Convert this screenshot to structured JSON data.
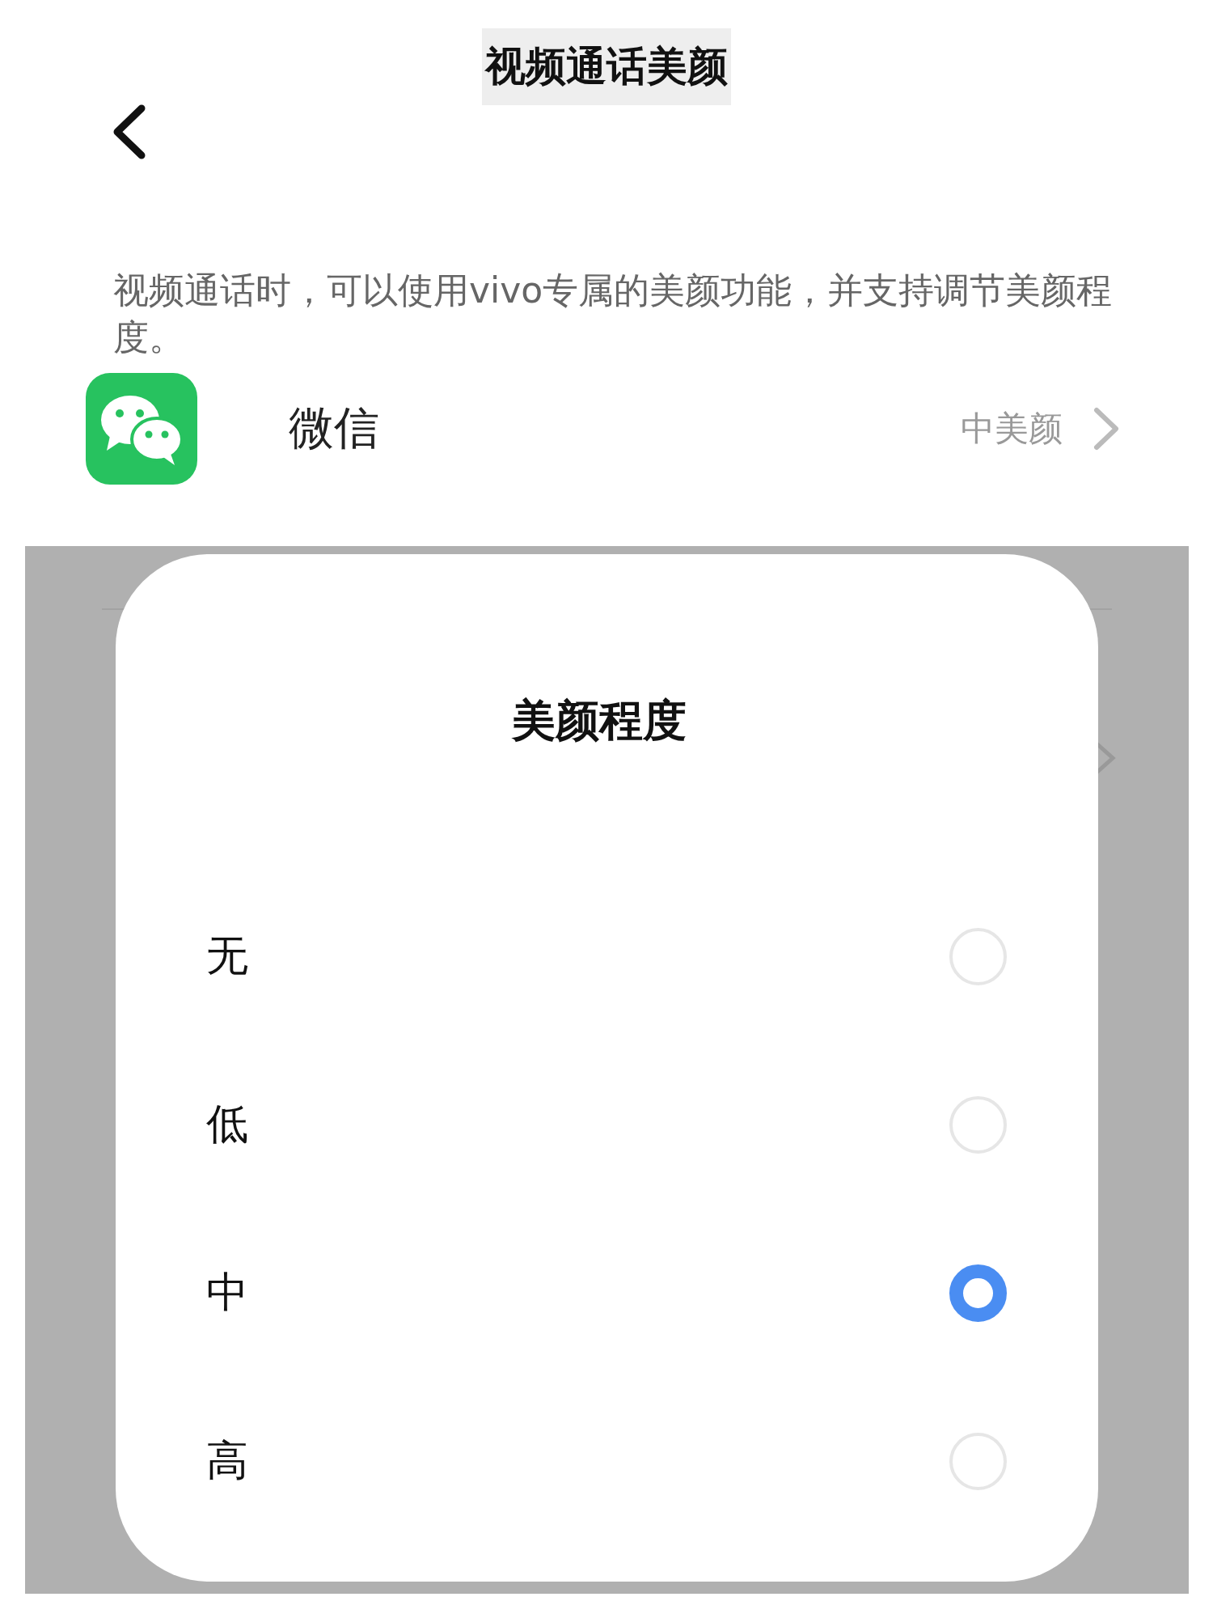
{
  "header": {
    "title": "视频通话美颜"
  },
  "description": "视频通话时，可以使用vivo专属的美颜功能，并支持调节美颜程度。",
  "apps": [
    {
      "name": "微信",
      "value": "中美颜"
    }
  ],
  "dialog": {
    "title": "美颜程度",
    "options": [
      {
        "label": "无",
        "selected": false
      },
      {
        "label": "低",
        "selected": false
      },
      {
        "label": "中",
        "selected": true
      },
      {
        "label": "高",
        "selected": false
      }
    ]
  }
}
